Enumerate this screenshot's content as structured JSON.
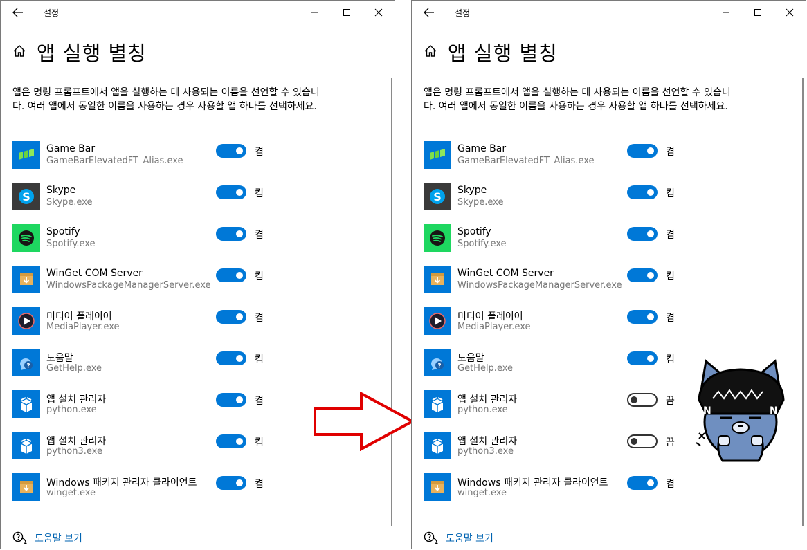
{
  "windows": [
    {
      "title": "설정",
      "page_title": "앱 실행 별칭",
      "description": "앱은 명령 프롬프트에서 앱을 실행하는 데 사용되는 이름을 선언할 수 있습니다. 여러 앱에서 동일한 이름을 사용하는 경우 사용할 앱 하나를 선택하세요.",
      "apps": [
        {
          "name": "Game Bar",
          "exe": "GameBarElevatedFT_Alias.exe",
          "state": "켬",
          "icon": "gamebar-icon"
        },
        {
          "name": "Skype",
          "exe": "Skype.exe",
          "state": "켬",
          "icon": "skype-icon"
        },
        {
          "name": "Spotify",
          "exe": "Spotify.exe",
          "state": "켬",
          "icon": "spotify-icon"
        },
        {
          "name": "WinGet COM Server",
          "exe": "WindowsPackageManagerServer.exe",
          "state": "켬",
          "icon": "package-icon"
        },
        {
          "name": "미디어 플레이어",
          "exe": "MediaPlayer.exe",
          "state": "켬",
          "icon": "media-player-icon"
        },
        {
          "name": "도움말",
          "exe": "GetHelp.exe",
          "state": "켬",
          "icon": "get-help-icon"
        },
        {
          "name": "앱 설치 관리자",
          "exe": "python.exe",
          "state": "켬",
          "icon": "app-installer-icon"
        },
        {
          "name": "앱 설치 관리자",
          "exe": "python3.exe",
          "state": "켬",
          "icon": "app-installer-icon"
        },
        {
          "name": "Windows 패키지 관리자 클라이언트",
          "exe": "winget.exe",
          "state": "켬",
          "icon": "package-icon"
        }
      ],
      "help_link": "도움말 보기"
    },
    {
      "title": "설정",
      "page_title": "앱 실행 별칭",
      "description": "앱은 명령 프롬프트에서 앱을 실행하는 데 사용되는 이름을 선언할 수 있습니다. 여러 앱에서 동일한 이름을 사용하는 경우 사용할 앱 하나를 선택하세요.",
      "apps": [
        {
          "name": "Game Bar",
          "exe": "GameBarElevatedFT_Alias.exe",
          "state": "켬",
          "icon": "gamebar-icon"
        },
        {
          "name": "Skype",
          "exe": "Skype.exe",
          "state": "켬",
          "icon": "skype-icon"
        },
        {
          "name": "Spotify",
          "exe": "Spotify.exe",
          "state": "켬",
          "icon": "spotify-icon"
        },
        {
          "name": "WinGet COM Server",
          "exe": "WindowsPackageManagerServer.exe",
          "state": "켬",
          "icon": "package-icon"
        },
        {
          "name": "미디어 플레이어",
          "exe": "MediaPlayer.exe",
          "state": "켬",
          "icon": "media-player-icon"
        },
        {
          "name": "도움말",
          "exe": "GetHelp.exe",
          "state": "켬",
          "icon": "get-help-icon"
        },
        {
          "name": "앱 설치 관리자",
          "exe": "python.exe",
          "state": "끔",
          "icon": "app-installer-icon"
        },
        {
          "name": "앱 설치 관리자",
          "exe": "python3.exe",
          "state": "끔",
          "icon": "app-installer-icon"
        },
        {
          "name": "Windows 패키지 관리자 클라이언트",
          "exe": "winget.exe",
          "state": "켬",
          "icon": "package-icon"
        }
      ],
      "help_link": "도움말 보기"
    }
  ],
  "colors": {
    "accent": "#0078d7",
    "link": "#0063b1",
    "tile": "#0078d7",
    "spotify": "#1ed760",
    "skype_bg": "#3a3a3a",
    "arrow": "#e00000"
  }
}
